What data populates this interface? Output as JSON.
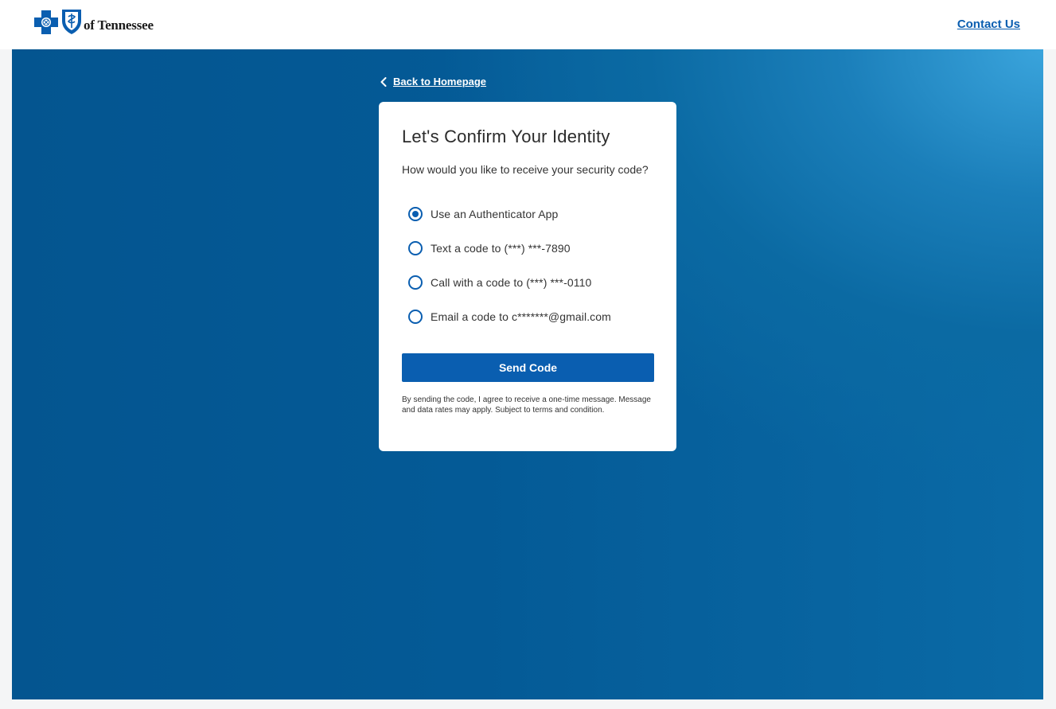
{
  "header": {
    "logo_text": "of Tennessee",
    "contact_label": "Contact Us"
  },
  "nav": {
    "back_label": "Back to Homepage"
  },
  "card": {
    "title": "Let's Confirm Your Identity",
    "question": "How would you like to receive your security code?",
    "options": [
      {
        "label": "Use an Authenticator App",
        "selected": true
      },
      {
        "label": "Text a code to (***) ***-7890",
        "selected": false
      },
      {
        "label": "Call with a code to (***) ***-0110",
        "selected": false
      },
      {
        "label": "Email a code to c*******@gmail.com",
        "selected": false
      }
    ],
    "send_label": "Send Code",
    "disclaimer": "By sending the code, I agree to receive a one-time message. Message and data rates may apply. Subject to terms and condition."
  },
  "colors": {
    "brand_blue": "#0a5eb0",
    "hero_dark": "#045590",
    "hero_light": "#3aa4dc"
  },
  "icons": [
    "blue-cross-icon",
    "blue-shield-icon",
    "chevron-left-icon"
  ]
}
